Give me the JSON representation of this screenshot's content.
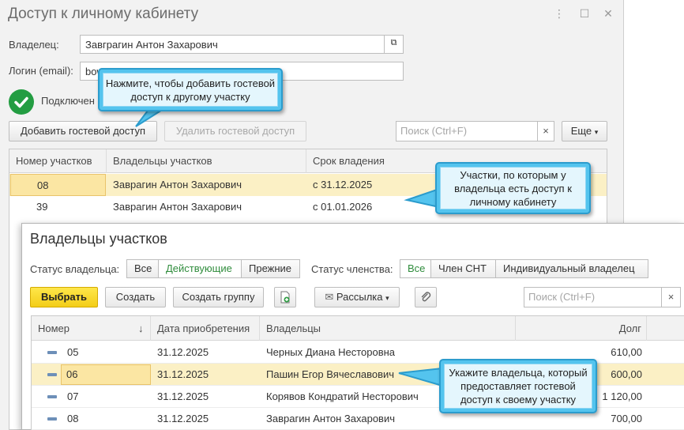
{
  "access_window": {
    "title": "Доступ к личному кабинету",
    "controls": {
      "more": "⋮",
      "maximize": "☐",
      "close": "✕"
    },
    "owner_label": "Владелец:",
    "owner_value": "Завграгин Антон Захарович",
    "login_label": "Логин (email):",
    "login_value": "bow",
    "status_text": "Подключен",
    "add_guest_button": "Добавить гостевой доступ",
    "delete_guest_button": "Удалить гостевой доступ",
    "search_placeholder": "Поиск (Ctrl+F)",
    "search_clear": "×",
    "more_button": "Еще",
    "table": {
      "columns": [
        "Номер участков",
        "Владельцы участков",
        "Срок владения"
      ],
      "rows": [
        {
          "number": "08",
          "owner": "Заврагин Антон Захарович",
          "period": "с 31.12.2025"
        },
        {
          "number": "39",
          "owner": "Заврагин Антон Захарович",
          "period": "с 01.01.2026"
        }
      ]
    }
  },
  "owners_window": {
    "title": "Владельцы участков",
    "owner_status_label": "Статус владельца:",
    "owner_status_options": [
      "Все",
      "Действующие",
      "Прежние"
    ],
    "membership_label": "Статус членства:",
    "membership_options": [
      "Все",
      "Член СНТ",
      "Индивидуальный владелец"
    ],
    "select_button": "Выбрать",
    "create_button": "Создать",
    "create_group_button": "Создать группу",
    "mailing_button": "Рассылка",
    "search_placeholder": "Поиск (Ctrl+F)",
    "search_clear": "×",
    "table": {
      "columns": [
        "Номер",
        "Дата приобретения",
        "Владельцы",
        "Долг"
      ],
      "sort_indicator": "↓",
      "rows": [
        {
          "number": "05",
          "date": "31.12.2025",
          "owner": "Черных Диана Несторовна",
          "debt": "610,00"
        },
        {
          "number": "06",
          "date": "31.12.2025",
          "owner": "Пашин Егор Вячеславович",
          "debt": "600,00"
        },
        {
          "number": "07",
          "date": "31.12.2025",
          "owner": "Корявов Кондратий Несторович",
          "debt": "1 120,00"
        },
        {
          "number": "08",
          "date": "31.12.2025",
          "owner": "Заврагин Антон Захарович",
          "debt": "700,00"
        }
      ]
    }
  },
  "callouts": {
    "add_guest_hint": "Нажмите, чтобы добавить гостевой доступ к другому участку",
    "plots_hint": "Участки, по которым у владельца есть доступ к личному кабинету",
    "owner_hint": "Укажите владельца, который предоставляет гостевой доступ к своему участку"
  },
  "colors": {
    "callout_border": "#2b9ccd",
    "callout_fill": "#e4f6fd",
    "selected_row": "#fbf0c5",
    "select_button": "#f3cd18",
    "status_green": "#239d42"
  }
}
